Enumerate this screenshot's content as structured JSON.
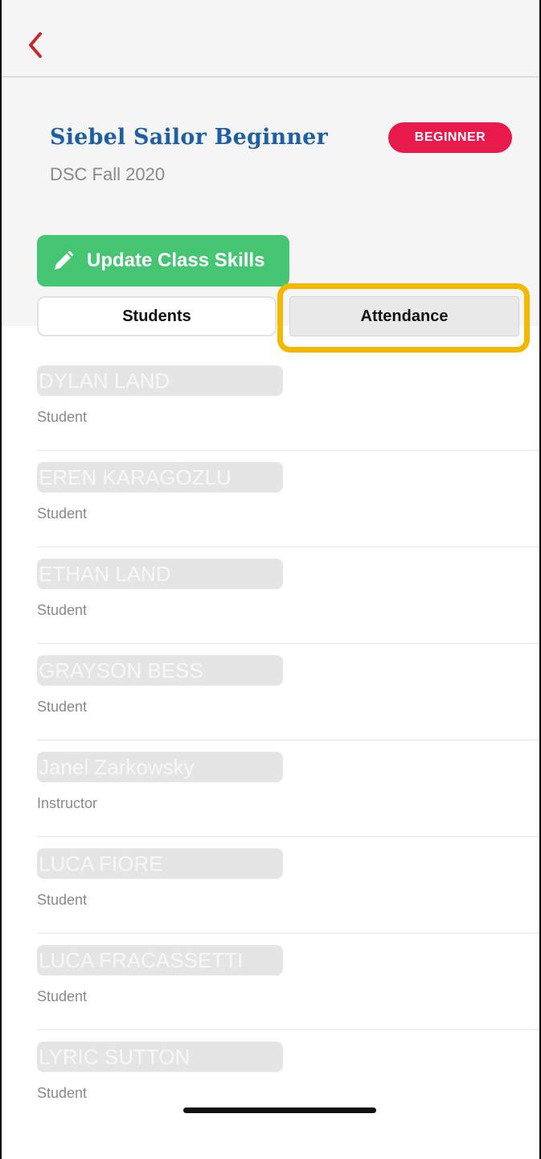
{
  "nav": {
    "back_icon": "chevron-left-icon",
    "accent": "#c8282d"
  },
  "class": {
    "title": "Siebel Sailor Beginner",
    "season": "DSC Fall 2020",
    "level_badge": "BEGINNER",
    "badge_color": "#e8194b",
    "title_color": "#1f5fa6"
  },
  "actions": {
    "update_label": "Update Class Skills",
    "update_icon": "pencil-icon",
    "update_color": "#46c672"
  },
  "tabs": [
    {
      "label": "Students",
      "selected": true
    },
    {
      "label": "Attendance",
      "selected": false
    }
  ],
  "roster": [
    {
      "name": "DYLAN LAND",
      "role": "Student"
    },
    {
      "name": "EREN KARAGOZLU",
      "role": "Student"
    },
    {
      "name": "ETHAN LAND",
      "role": "Student"
    },
    {
      "name": "GRAYSON BESS",
      "role": "Student"
    },
    {
      "name": "Janel Zarkowsky",
      "role": "Instructor"
    },
    {
      "name": "LUCA FIORE",
      "role": "Student"
    },
    {
      "name": "LUCA FRACASSETTI",
      "role": "Student"
    },
    {
      "name": "LYRIC SUTTON",
      "role": "Student"
    }
  ]
}
